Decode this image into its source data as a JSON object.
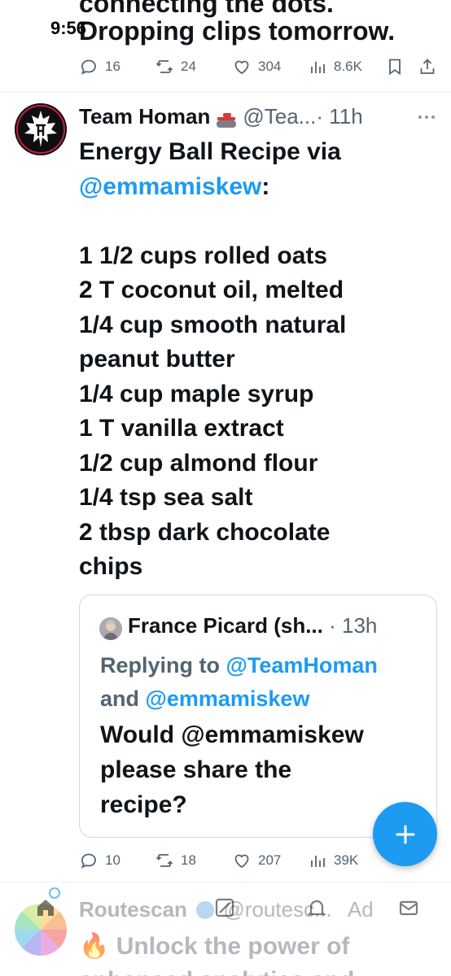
{
  "status_bar": {
    "time": "9:56"
  },
  "previous_tweet": {
    "cut_text": "connecting the dots.",
    "line2": "Dropping clips tomorrow.",
    "replies": "16",
    "retweets": "24",
    "likes": "304",
    "views": "8.6K"
  },
  "tweet": {
    "author_name": "Team Homan",
    "author_handle": "@Tea...",
    "time": "· 11h",
    "intro_text": "Energy Ball Recipe via",
    "intro_mention": "@emmamiskew",
    "intro_colon": ":",
    "recipe_lines": [
      "1 1/2 cups rolled oats",
      "2 T coconut oil, melted",
      "1/4 cup smooth natural",
      "peanut butter",
      "1/4 cup maple syrup",
      "1 T vanilla extract",
      "1/2 cup almond flour",
      "1/4 tsp sea salt",
      "2 tbsp dark chocolate",
      "chips"
    ],
    "replies": "10",
    "retweets": "18",
    "likes": "207",
    "views": "39K"
  },
  "quoted_tweet": {
    "author_name": "France Picard (sh...",
    "time": " · 13h",
    "replying_prefix": "Replying to ",
    "replying_mention_1": "@TeamHoman",
    "replying_and": "and ",
    "replying_mention_2": "@emmamiskew",
    "text_line1": "Would @emmamiskew",
    "text_line2": "please share the",
    "text_line3": "recipe?"
  },
  "next_tweet": {
    "author_name": "Routescan",
    "author_handle": "@routesc...",
    "ad_label": "Ad",
    "fire_emoji": "🔥",
    "body_line1": "Unlock the power of",
    "body_line2": "enhanced analytics and"
  },
  "colors": {
    "accent": "#1d9bf0",
    "text": "#0f1419",
    "secondary_text": "#536471"
  }
}
